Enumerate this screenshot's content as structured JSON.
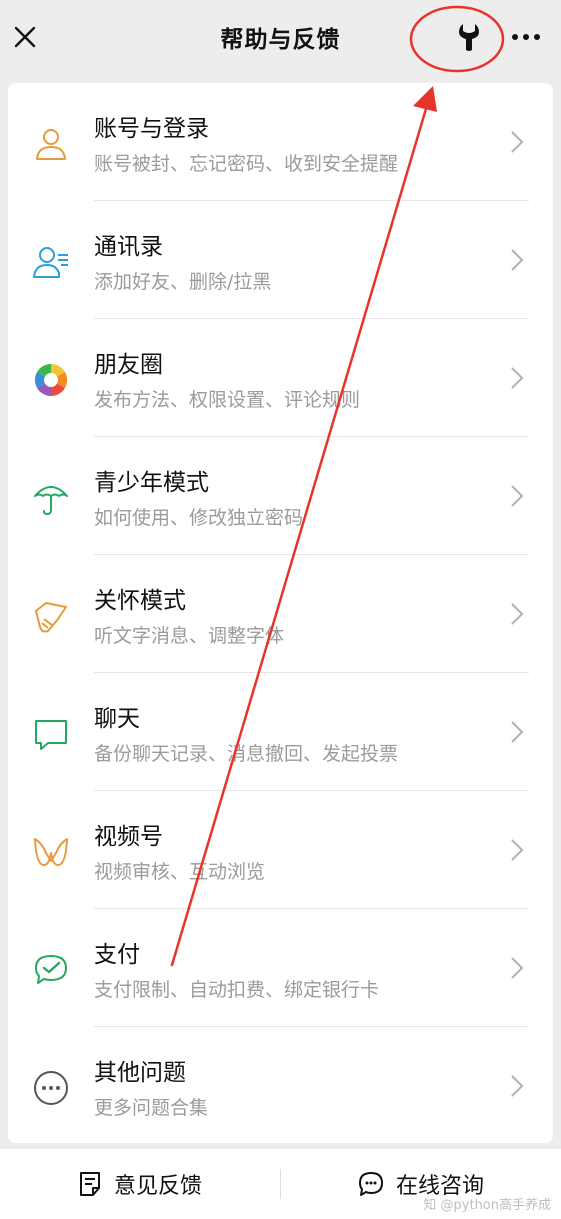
{
  "header": {
    "title": "帮助与反馈",
    "close_icon": "close-icon",
    "wrench_icon": "wrench-icon",
    "more_icon": "more-icon"
  },
  "items": [
    {
      "title": "账号与登录",
      "subtitle": "账号被封、忘记密码、收到安全提醒",
      "icon": "user-icon",
      "color": "#E89A3C"
    },
    {
      "title": "通讯录",
      "subtitle": "添加好友、删除/拉黑",
      "icon": "contacts-icon",
      "color": "#2A9FD8"
    },
    {
      "title": "朋友圈",
      "subtitle": "发布方法、权限设置、评论规则",
      "icon": "moments-icon",
      "color": "#E6A23C"
    },
    {
      "title": "青少年模式",
      "subtitle": "如何使用、修改独立密码",
      "icon": "umbrella-icon",
      "color": "#24A960"
    },
    {
      "title": "关怀模式",
      "subtitle": "听文字消息、调整字体",
      "icon": "care-icon",
      "color": "#E89A3C"
    },
    {
      "title": "聊天",
      "subtitle": "备份聊天记录、消息撤回、发起投票",
      "icon": "chat-icon",
      "color": "#24A960"
    },
    {
      "title": "视频号",
      "subtitle": "视频审核、互动浏览",
      "icon": "channels-icon",
      "color": "#E89A3C"
    },
    {
      "title": "支付",
      "subtitle": "支付限制、自动扣费、绑定银行卡",
      "icon": "pay-icon",
      "color": "#24A960"
    },
    {
      "title": "其他问题",
      "subtitle": "更多问题合集",
      "icon": "more-circle-icon",
      "color": "#555555"
    }
  ],
  "bottom": {
    "feedback_label": "意见反馈",
    "consult_label": "在线咨询"
  },
  "watermark": "知 @python高手养成",
  "colors": {
    "annotation": "#E8332A",
    "background": "#EDEDED"
  }
}
